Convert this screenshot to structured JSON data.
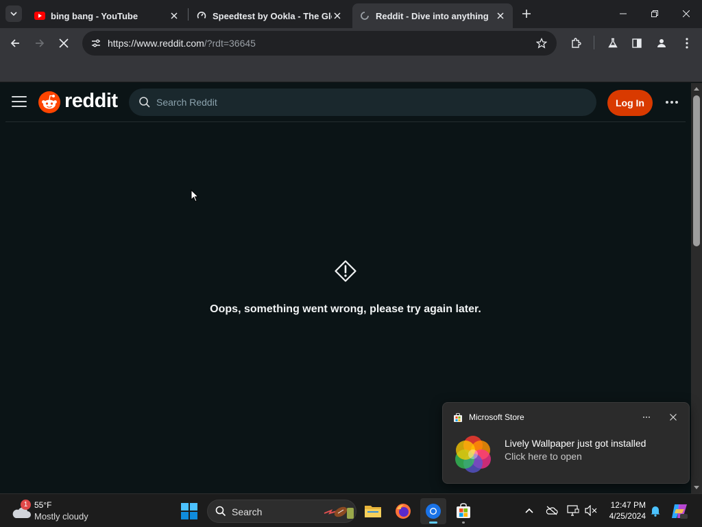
{
  "browser": {
    "tabs": [
      {
        "title": "bing bang - YouTube",
        "active": false
      },
      {
        "title": "Speedtest by Ookla - The Global Broadband Speed Test",
        "active": false
      },
      {
        "title": "Reddit - Dive into anything",
        "active": true
      }
    ],
    "url_host": "https://www.reddit.com",
    "url_path": "/?rdt=36645"
  },
  "reddit": {
    "logo_text": "reddit",
    "search_placeholder": "Search Reddit",
    "login_label": "Log In",
    "error_message": "Oops, something went wrong, please try again later."
  },
  "toast": {
    "app_name": "Microsoft Store",
    "title": "Lively Wallpaper just got installed",
    "subtitle": "Click here to open"
  },
  "taskbar": {
    "weather_badge": "1",
    "temperature": "55°F",
    "condition": "Mostly cloudy",
    "search_label": "Search",
    "time": "12:47 PM",
    "date": "4/25/2024"
  },
  "colors": {
    "reddit_orange": "#d93a00",
    "page_background": "#0b1416",
    "chrome_frame": "#202124",
    "chrome_toolbar": "#35363a"
  }
}
